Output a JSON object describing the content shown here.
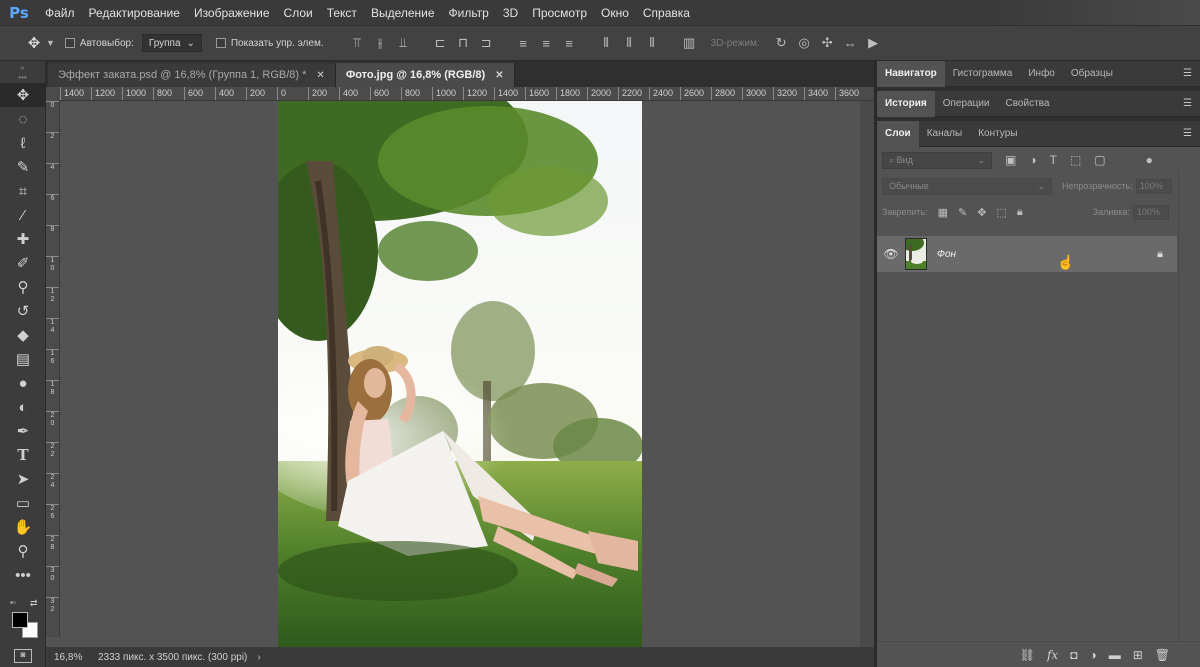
{
  "app": {
    "logo": "Ps"
  },
  "menu": [
    "Файл",
    "Редактирование",
    "Изображение",
    "Слои",
    "Текст",
    "Выделение",
    "Фильтр",
    "3D",
    "Просмотр",
    "Окно",
    "Справка"
  ],
  "options": {
    "autoselect_label": "Автовыбор:",
    "autoselect_value": "Группа",
    "show_controls_label": "Показать упр. элем.",
    "mode_3d_label": "3D-режим:"
  },
  "tabs": [
    {
      "title": "Эффект заката.psd @ 16,8% (Группа 1, RGB/8) *",
      "active": false
    },
    {
      "title": "Фото.jpg @ 16,8% (RGB/8)",
      "active": true
    }
  ],
  "ruler_h": [
    "1400",
    "1200",
    "1000",
    "800",
    "600",
    "400",
    "200",
    "0",
    "200",
    "400",
    "600",
    "800",
    "1000",
    "1200",
    "1400",
    "1600",
    "1800",
    "2000",
    "2200",
    "2400",
    "2600",
    "2800",
    "3000",
    "3200",
    "3400",
    "3600"
  ],
  "ruler_v": [
    "0",
    "2",
    "4",
    "6",
    "8",
    "1 0",
    "1 2",
    "1 4",
    "1 6",
    "1 8",
    "2 0",
    "2 2",
    "2 4",
    "2 6",
    "2 8",
    "3 0",
    "3 2"
  ],
  "status": {
    "zoom": "16,8%",
    "doc_size": "2333 пикс. x 3500 пикс. (300 ppi)"
  },
  "panels": {
    "row1": [
      "Навигатор",
      "Гистограмма",
      "Инфо",
      "Образцы"
    ],
    "row2": [
      "История",
      "Операции",
      "Свойства"
    ],
    "row3": [
      "Слои",
      "Каналы",
      "Контуры"
    ],
    "filter_placeholder": "Вид",
    "blend_mode": "Обычные",
    "opacity_label": "Непрозрачность:",
    "opacity_value": "100%",
    "lock_label": "Закрепить:",
    "fill_label": "Заливка:",
    "fill_value": "100%",
    "layer_name": "Фон"
  },
  "colors": {
    "foreground": "#000000",
    "background": "#ffffff",
    "accent": "#5aa8ff"
  }
}
